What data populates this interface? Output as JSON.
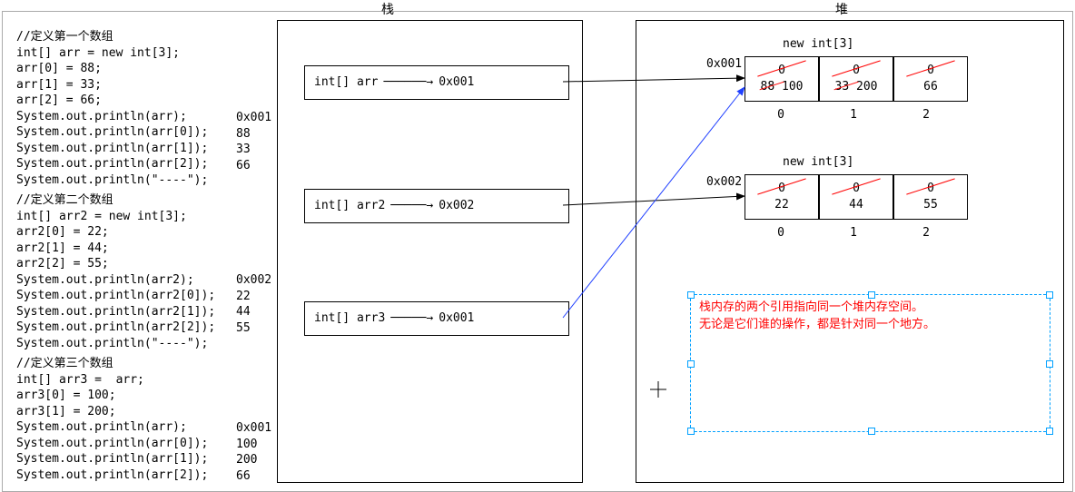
{
  "titles": {
    "stack": "栈",
    "heap": "堆"
  },
  "code": {
    "block1": "//定义第一个数组\nint[] arr = new int[3];\narr[0] = 88;\narr[1] = 33;\narr[2] = 66;\nSystem.out.println(arr);\nSystem.out.println(arr[0]);\nSystem.out.println(arr[1]);\nSystem.out.println(arr[2]);\nSystem.out.println(\"----\");",
    "block2": "//定义第二个数组\nint[] arr2 = new int[3];\narr2[0] = 22;\narr2[1] = 44;\narr2[2] = 55;\nSystem.out.println(arr2);\nSystem.out.println(arr2[0]);\nSystem.out.println(arr2[1]);\nSystem.out.println(arr2[2]);\nSystem.out.println(\"----\");",
    "block3": "//定义第三个数组\nint[] arr3 =  arr;\narr3[0] = 100;\narr3[1] = 200;\nSystem.out.println(arr);\nSystem.out.println(arr[0]);\nSystem.out.println(arr[1]);\nSystem.out.println(arr[2]);"
  },
  "ann": {
    "a1": "0x001\n88\n33\n66",
    "a2": "0x002\n22\n44\n55",
    "a3": "0x001\n100\n200\n66"
  },
  "stack": {
    "v1": {
      "name": "int[] arr",
      "addr": "0x001"
    },
    "v2": {
      "name": "int[] arr2",
      "addr": "0x002"
    },
    "v3": {
      "name": "int[] arr3",
      "addr": "0x001"
    }
  },
  "heap": {
    "h1": {
      "label": "new int[3]",
      "addr": "0x001",
      "cells": [
        {
          "init": "0",
          "old": "88",
          "new": "100",
          "idx": "0",
          "oldStruck": true,
          "initStruck": true
        },
        {
          "init": "0",
          "old": "33",
          "new": "200",
          "idx": "1",
          "oldStruck": true,
          "initStruck": true
        },
        {
          "init": "0",
          "old": "",
          "new": "66",
          "idx": "2",
          "oldStruck": false,
          "initStruck": true
        }
      ]
    },
    "h2": {
      "label": "new int[3]",
      "addr": "0x002",
      "cells": [
        {
          "init": "0",
          "new": "22",
          "idx": "0"
        },
        {
          "init": "0",
          "new": "44",
          "idx": "1"
        },
        {
          "init": "0",
          "new": "55",
          "idx": "2"
        }
      ]
    }
  },
  "note": {
    "line1": "栈内存的两个引用指向同一个堆内存空间。",
    "line2": "无论是它们谁的操作，都是针对同一个地方。"
  }
}
